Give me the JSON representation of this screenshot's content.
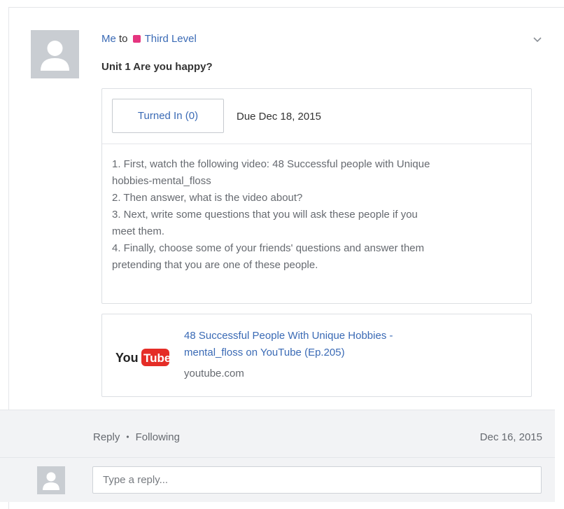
{
  "post": {
    "sender": "Me",
    "to_word": "to",
    "group_color": "#e5357f",
    "group_name": "Third Level",
    "title": "Unit 1 Are you happy?",
    "avatar_icon": "user-avatar-icon",
    "menu_icon": "chevron-down-icon"
  },
  "assignment": {
    "turned_in_label": "Turned In (0)",
    "due_label": "Due Dec 18, 2015",
    "instructions": [
      "1. First, watch the following video: 48 Successful people with Unique",
      "hobbies-mental_floss",
      "2. Then answer, what is the video about?",
      "3. Next, write some questions that you will ask these people if you",
      "meet them.",
      "4. Finally, choose some of your friends' questions and answer them",
      "pretending that you are one of these people."
    ]
  },
  "link": {
    "logo_icon": "youtube-logo-icon",
    "logo_text_you": "You",
    "logo_text_tube": "Tube",
    "title_line1": "48 Successful People With Unique Hobbies -",
    "title_line2": "mental_floss on YouTube (Ep.205)",
    "domain": "youtube.com"
  },
  "footer": {
    "reply_label": "Reply",
    "separator": "•",
    "following_label": "Following",
    "date": "Dec 16, 2015"
  },
  "reply": {
    "placeholder": "Type a reply..."
  },
  "colors": {
    "accent": "#3a6ab5",
    "group": "#e5357f",
    "youtube_red": "#e52d27"
  }
}
